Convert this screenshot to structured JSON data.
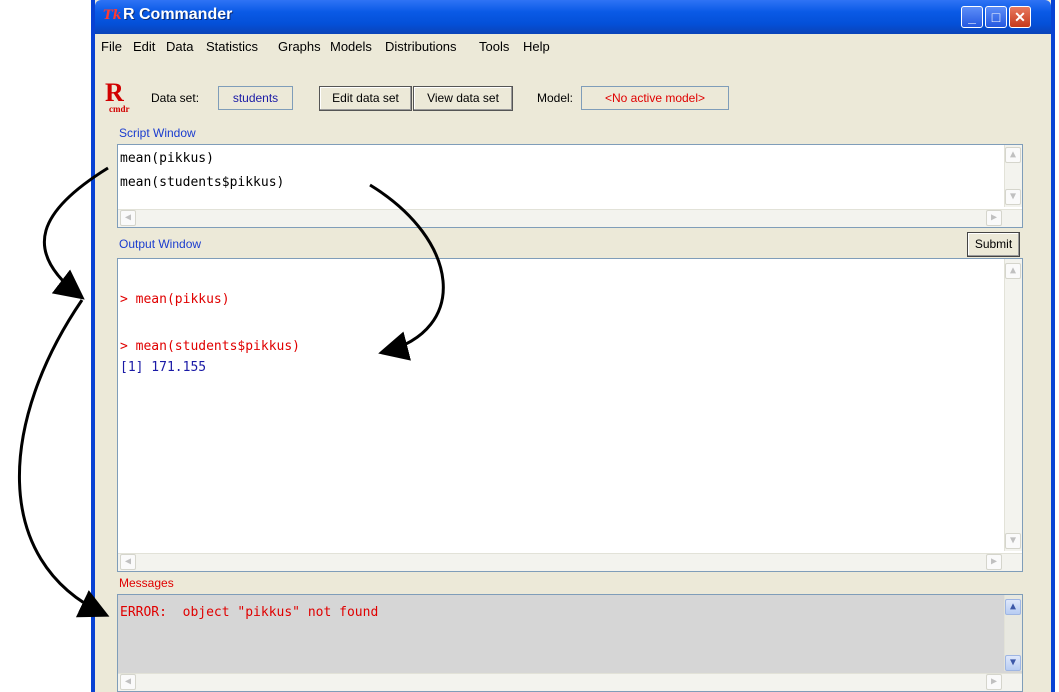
{
  "window": {
    "title": "R Commander",
    "icon_text": "Tk",
    "controls": [
      "_",
      "□",
      "✕"
    ]
  },
  "menu": [
    "File",
    "Edit",
    "Data",
    "Statistics",
    "Graphs",
    "Models",
    "Distributions",
    "Tools",
    "Help"
  ],
  "toolbar": {
    "logo_main": "R",
    "logo_sub": "cmdr",
    "dataset_label": "Data set:",
    "dataset_value": "students",
    "edit_button": "Edit data set",
    "view_button": "View data set",
    "model_label": "Model:",
    "model_value": "<No active model>"
  },
  "script": {
    "label": "Script Window",
    "lines": [
      "mean(pikkus)",
      "mean(students$pikkus)"
    ]
  },
  "output": {
    "label": "Output Window",
    "submit_label": "Submit",
    "lines": [
      "> mean(pikkus)",
      "> mean(students$pikkus)",
      "[1] 171.155"
    ]
  },
  "messages": {
    "label": "Messages",
    "lines": [
      "ERROR:  object \"pikkus\" not found"
    ]
  },
  "colors": {
    "command": "#e00000",
    "result": "#1a1aa6",
    "section_label": "#1a3ccf",
    "titlebar": "#0a5ae6"
  }
}
